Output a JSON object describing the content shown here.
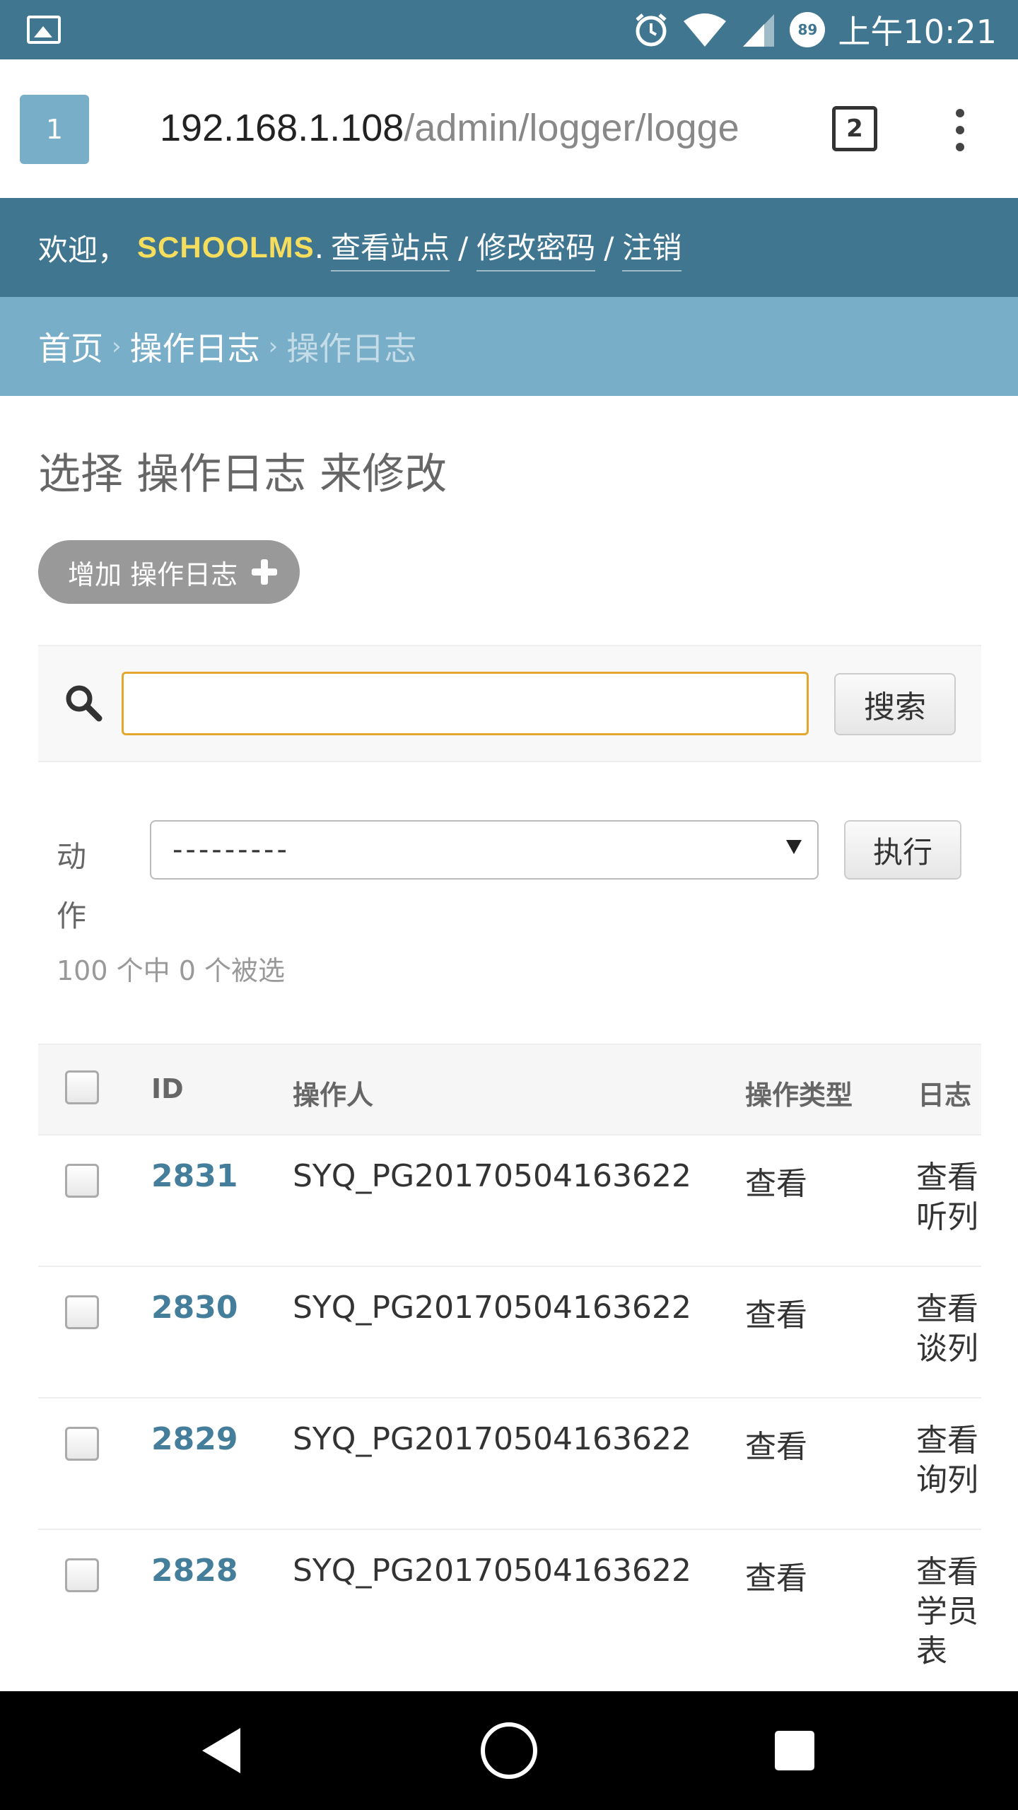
{
  "status_bar": {
    "time": "上午10:21",
    "battery_level": "89",
    "icons": [
      "gallery-icon",
      "alarm-icon",
      "wifi-icon",
      "signal-icon",
      "battery-icon"
    ]
  },
  "browser": {
    "tab_label": "1",
    "url_host": "192.168.1.108",
    "url_path": "/admin/logger/logge",
    "tab_count": "2"
  },
  "header": {
    "welcome": "欢迎，",
    "username": "SCHOOLMS",
    "period": ".",
    "links": [
      "查看站点",
      "修改密码",
      "注销"
    ],
    "separator": "/"
  },
  "breadcrumbs": {
    "home": "首页",
    "app": "操作日志",
    "current": "操作日志",
    "arrow": "›"
  },
  "content": {
    "title": "选择 操作日志 来修改",
    "add_button": "增加 操作日志"
  },
  "search": {
    "value": "",
    "placeholder": "",
    "button": "搜索"
  },
  "actions": {
    "label": "动作",
    "selected": "---------",
    "go_button": "执行",
    "selection_count": "100 个中 0 个被选"
  },
  "table": {
    "headers": [
      "ID",
      "操作人",
      "操作类型",
      "日志"
    ],
    "rows": [
      {
        "id": "2831",
        "operator": "SYQ_PG20170504163622",
        "type": "查看",
        "desc": "查看听列"
      },
      {
        "id": "2830",
        "operator": "SYQ_PG20170504163622",
        "type": "查看",
        "desc": "查看谈列"
      },
      {
        "id": "2829",
        "operator": "SYQ_PG20170504163622",
        "type": "查看",
        "desc": "查看询列"
      },
      {
        "id": "2828",
        "operator": "SYQ_PG20170504163622",
        "type": "查看",
        "desc": "查看学员表"
      }
    ]
  },
  "colors": {
    "header_bg": "#417690",
    "breadcrumb_bg": "#79aec8",
    "username": "#f5dd5d",
    "link": "#447e9b",
    "search_focus": "#e3a72f"
  }
}
